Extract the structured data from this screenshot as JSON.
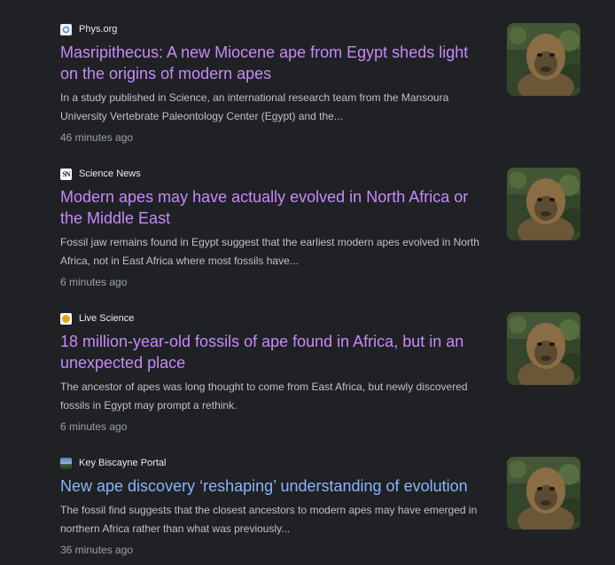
{
  "articles": [
    {
      "source": "Phys.org",
      "favicon": "physorg-icon",
      "headline": "Masripithecus: A new Miocene ape from Egypt sheds light on the origins of modern apes",
      "snippet": "In a study published in Science, an international research team from the Mansoura University Vertebrate Paleontology Center (Egypt) and the...",
      "time": "46 minutes ago",
      "visited": true
    },
    {
      "source": "Science News",
      "favicon": "science-news-icon",
      "favicon_text": "SN",
      "headline": "Modern apes may have actually evolved in North Africa or the Middle East",
      "snippet": "Fossil jaw remains found in Egypt suggest that the earliest modern apes evolved in North Africa, not in East Africa where most fossils have...",
      "time": "6 minutes ago",
      "visited": true
    },
    {
      "source": "Live Science",
      "favicon": "live-science-icon",
      "headline": "18 million-year-old fossils of ape found in Africa, but in an unexpected place",
      "snippet": "The ancestor of apes was long thought to come from East Africa, but newly discovered fossils in Egypt may prompt a rethink.",
      "time": "6 minutes ago",
      "visited": true
    },
    {
      "source": "Key Biscayne Portal",
      "favicon": "key-biscayne-portal-icon",
      "headline": "New ape discovery ‘reshaping’ understanding of evolution",
      "snippet": "The fossil find suggests that the closest ancestors to modern apes may have emerged in northern Africa rather than what was previously...",
      "time": "36 minutes ago",
      "visited": false
    }
  ],
  "colors": {
    "background": "#202124",
    "headline_visited": "#c58af9",
    "headline_unvisited": "#8ab4f8",
    "snippet": "#bdc1c6",
    "timestamp": "#9aa0a6",
    "source": "#e8eaed"
  }
}
